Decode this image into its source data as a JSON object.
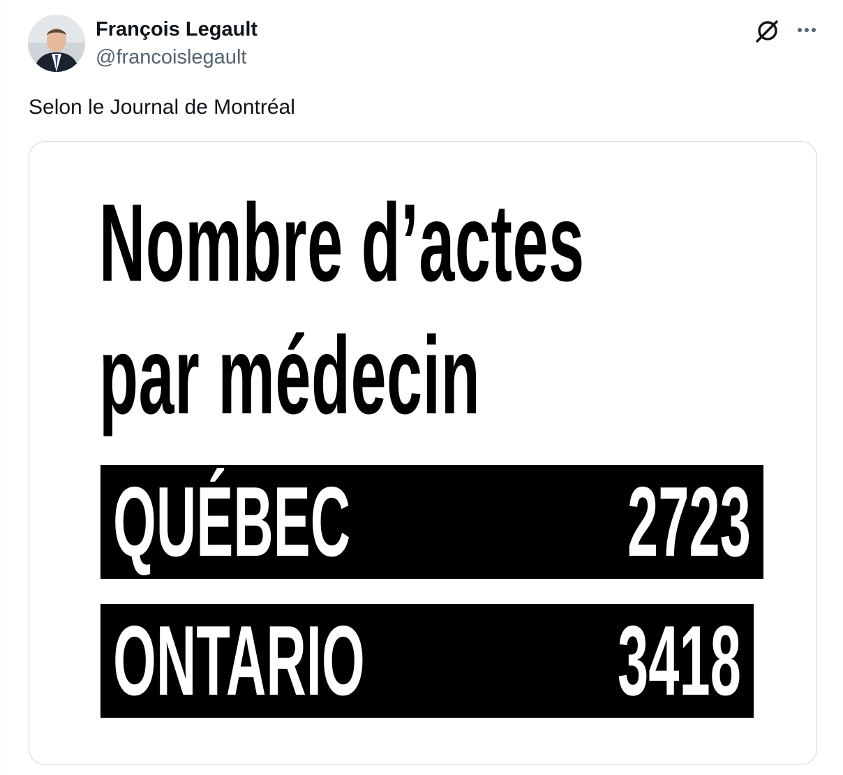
{
  "tweet": {
    "author": {
      "display_name": "François Legault",
      "handle": "@francoislegault"
    },
    "text": "Selon le Journal de Montréal",
    "actions": {
      "grok_icon": "grok-icon",
      "more_icon": "more-icon"
    },
    "media": {
      "headline_line1": "Nombre d’actes",
      "headline_line2": "par médecin",
      "rows": [
        {
          "label": "QUÉBEC",
          "value": "2723"
        },
        {
          "label": "ONTARIO",
          "value": "3418"
        }
      ]
    }
  },
  "colors": {
    "text": "#0f1419",
    "secondary_text": "#536471",
    "card_border": "#cfd9de",
    "graphic_black": "#000000"
  }
}
